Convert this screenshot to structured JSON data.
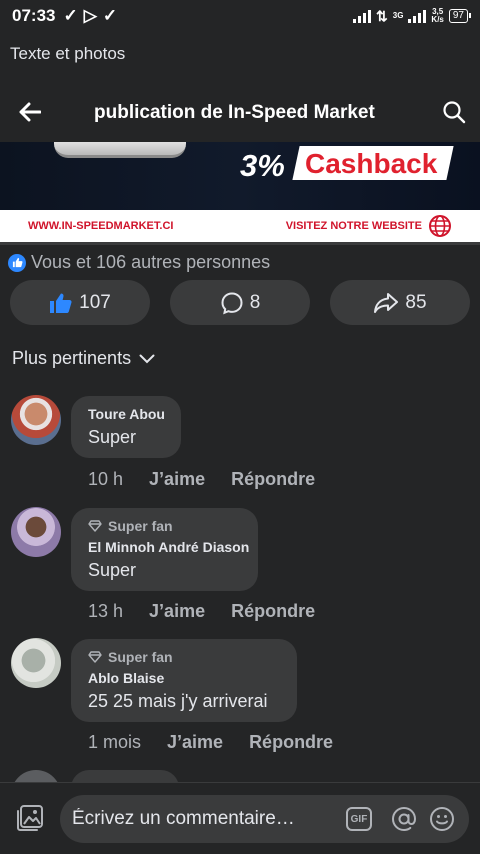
{
  "status_bar": {
    "time": "07:33",
    "net_label": "3G",
    "speed_value": "3,5",
    "speed_unit": "K/s",
    "battery": "97"
  },
  "breadcrumb": "Texte et photos",
  "header": {
    "title": "publication de In-Speed Market",
    "back_icon": "arrow-left-icon",
    "search_icon": "search-icon"
  },
  "banner": {
    "cashback_value": "3%",
    "cashback_label": "Cashback",
    "site_url": "WWW.IN-SPEEDMARKET.CI",
    "visit_label": "VISITEZ NOTRE WEBSITE",
    "accent_color": "#d0142b"
  },
  "reactions": {
    "summary": "Vous et 106 autres personnes",
    "like_count": "107",
    "comment_count": "8",
    "share_count": "85"
  },
  "sort": {
    "label": "Plus pertinents"
  },
  "comments": [
    {
      "author": "Toure Abou",
      "badge": "",
      "text": "Super",
      "time": "10 h",
      "like_label": "J’aime",
      "reply_label": "Répondre"
    },
    {
      "author": "El Minnoh André Diason",
      "badge": "Super fan",
      "text": "Super",
      "time": "13 h",
      "like_label": "J’aime",
      "reply_label": "Répondre"
    },
    {
      "author": "Ablo Blaise",
      "badge": "Super fan",
      "text": "25 25 mais j'y arriverai",
      "time": "1 mois",
      "like_label": "J’aime",
      "reply_label": "Répondre"
    }
  ],
  "composer": {
    "placeholder": "Écrivez un commentaire…",
    "gif_label": "GIF"
  },
  "colors": {
    "background": "#242526",
    "surface": "#3a3b3c",
    "like_blue": "#2d88ff"
  }
}
